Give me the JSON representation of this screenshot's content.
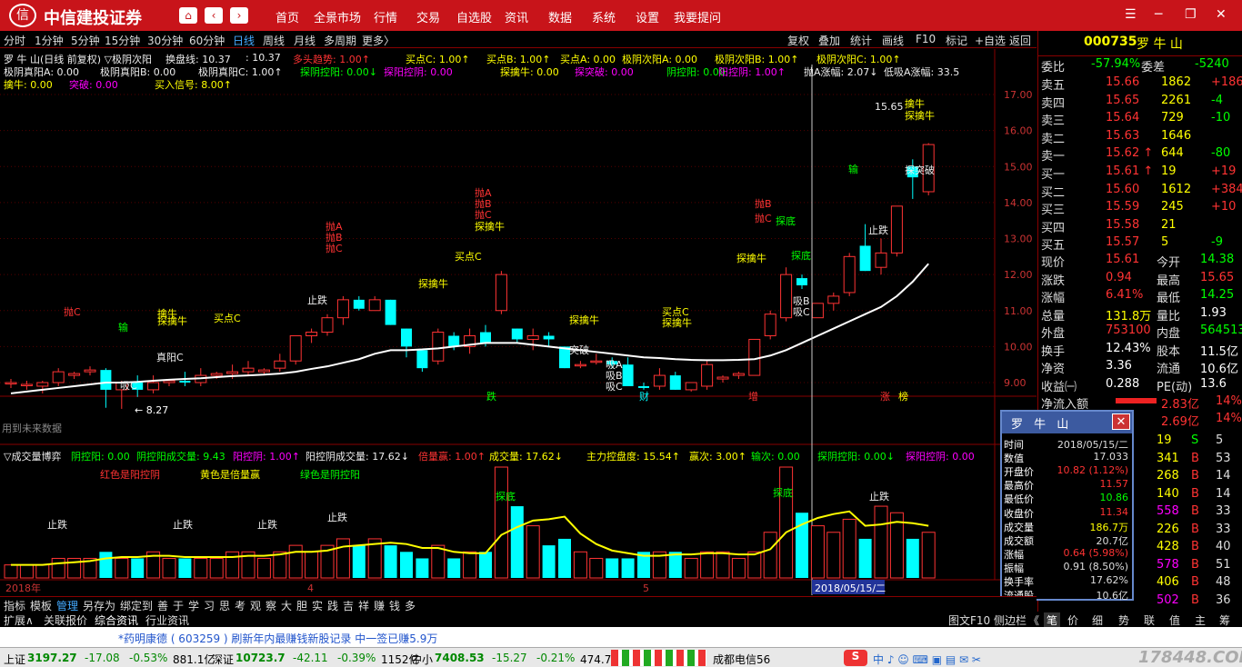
{
  "app": {
    "title": "中信建投证券",
    "logo_glyph": "信"
  },
  "menu": [
    "首页",
    "全景市场",
    "行情",
    "交易",
    "自选股",
    "资讯",
    "数据",
    "系统",
    "设置",
    "我要提问"
  ],
  "timeframes": [
    "分时",
    "1分钟",
    "5分钟",
    "15分钟",
    "30分钟",
    "60分钟",
    "日线",
    "周线",
    "月线",
    "多周期",
    "更多〉"
  ],
  "active_timeframe": "日线",
  "toolbar_right": [
    "复权",
    "叠加",
    "统计",
    "画线",
    "F10",
    "标记",
    "+自选",
    "返回"
  ],
  "indicators": {
    "row1": [
      {
        "t": "罗 牛 山(日线 前复权) ▽极阴次阳",
        "c": "w"
      },
      {
        "t": "换盘线: 10.37",
        "c": "w"
      },
      {
        "t": ": 10.37",
        "c": "w"
      },
      {
        "t": "多头趋势: 1.00↑",
        "c": "r"
      },
      {
        "t": "买点C: 1.00↑",
        "c": "y"
      },
      {
        "t": "买点B: 1.00↑",
        "c": "y"
      },
      {
        "t": "买点A: 0.00",
        "c": "y"
      },
      {
        "t": "极阴次阳A: 0.00",
        "c": "y"
      },
      {
        "t": "极阴次阳B: 1.00↑",
        "c": "y"
      },
      {
        "t": "极阴次阳C: 1.00↑",
        "c": "y"
      }
    ],
    "row2": [
      {
        "t": "极阴真阳A: 0.00",
        "c": "w"
      },
      {
        "t": "极阴真阳B: 0.00",
        "c": "w"
      },
      {
        "t": "极阴真阳C: 1.00↑",
        "c": "w"
      },
      {
        "t": "探阴控阳: 0.00↓",
        "c": "g"
      },
      {
        "t": "探阳控阴: 0.00",
        "c": "m"
      },
      {
        "t": "探擒牛: 0.00",
        "c": "y"
      },
      {
        "t": "探突破: 0.00",
        "c": "m"
      },
      {
        "t": "阴控阳: 0.00",
        "c": "g"
      },
      {
        "t": "阳控阴: 1.00↑",
        "c": "m"
      },
      {
        "t": "抛A涨幅: 2.07↓",
        "c": "w"
      },
      {
        "t": "低吸A涨幅: 33.5",
        "c": "w"
      }
    ],
    "row3": [
      {
        "t": "擒牛: 0.00",
        "c": "y"
      },
      {
        "t": "突破: 0.00",
        "c": "m"
      },
      {
        "t": "买入信号: 8.00↑",
        "c": "y"
      }
    ]
  },
  "volume_indicators": {
    "row1": [
      {
        "t": "▽成交量博弈",
        "c": "w"
      },
      {
        "t": "阴控阳: 0.00",
        "c": "g"
      },
      {
        "t": "阴控阳成交量: 9.43",
        "c": "g"
      },
      {
        "t": "阳控阴: 1.00↑",
        "c": "m"
      },
      {
        "t": "阳控阴成交量: 17.62↓",
        "c": "w"
      },
      {
        "t": "倍量赢: 1.00↑",
        "c": "r"
      },
      {
        "t": "成交量: 17.62↓",
        "c": "y"
      },
      {
        "t": "主力控盘度: 15.54↑",
        "c": "y"
      },
      {
        "t": "赢次: 3.00↑",
        "c": "y"
      },
      {
        "t": "输次: 0.00",
        "c": "g"
      },
      {
        "t": "探阴控阳: 0.00↓",
        "c": "g"
      },
      {
        "t": "探阳控阴: 0.00",
        "c": "m"
      }
    ],
    "row2": [
      {
        "t": "红色是阳控阴",
        "c": "r"
      },
      {
        "t": "黄色是倍量赢",
        "c": "y"
      },
      {
        "t": "绿色是阴控阳",
        "c": "g"
      }
    ]
  },
  "chart_data": {
    "type": "candlestick",
    "y_ticks": [
      "17.00",
      "16.00",
      "15.00",
      "14.00",
      "13.00",
      "12.00",
      "11.00",
      "10.00",
      "9.00"
    ],
    "ylim": [
      8.6,
      17.3
    ],
    "x_labels": [
      "2018年",
      "4",
      "5"
    ],
    "cursor_date": "2018/05/15/二",
    "max_label": "15.65",
    "min_label": "8.27",
    "future_note": "用到未来数据",
    "candles": [
      {
        "o": 9.0,
        "h": 9.1,
        "l": 8.85,
        "c": 9.0
      },
      {
        "o": 8.95,
        "h": 9.05,
        "l": 8.8,
        "c": 8.95
      },
      {
        "o": 8.9,
        "h": 9.05,
        "l": 8.7,
        "c": 9.0
      },
      {
        "o": 9.0,
        "h": 9.4,
        "l": 8.9,
        "c": 9.3
      },
      {
        "o": 9.2,
        "h": 9.3,
        "l": 9.1,
        "c": 9.25
      },
      {
        "o": 9.3,
        "h": 9.45,
        "l": 9.2,
        "c": 9.35
      },
      {
        "o": 9.35,
        "h": 9.4,
        "l": 8.3,
        "c": 8.8
      },
      {
        "o": 8.8,
        "h": 9.05,
        "l": 8.27,
        "c": 9.0
      },
      {
        "o": 9.0,
        "h": 9.2,
        "l": 8.6,
        "c": 8.8
      },
      {
        "o": 8.8,
        "h": 9.2,
        "l": 8.7,
        "c": 9.0
      },
      {
        "o": 9.0,
        "h": 9.1,
        "l": 8.9,
        "c": 9.05
      },
      {
        "o": 9.05,
        "h": 9.3,
        "l": 8.9,
        "c": 9.0
      },
      {
        "o": 9.0,
        "h": 9.4,
        "l": 8.9,
        "c": 9.2
      },
      {
        "o": 9.2,
        "h": 9.3,
        "l": 9.1,
        "c": 9.25
      },
      {
        "o": 9.25,
        "h": 9.5,
        "l": 9.1,
        "c": 9.3
      },
      {
        "o": 9.3,
        "h": 9.6,
        "l": 9.2,
        "c": 9.4
      },
      {
        "o": 9.3,
        "h": 9.4,
        "l": 9.2,
        "c": 9.35
      },
      {
        "o": 9.4,
        "h": 9.8,
        "l": 9.3,
        "c": 9.6
      },
      {
        "o": 9.6,
        "h": 10.3,
        "l": 9.5,
        "c": 10.3
      },
      {
        "o": 10.3,
        "h": 10.5,
        "l": 10.1,
        "c": 10.4
      },
      {
        "o": 10.4,
        "h": 10.9,
        "l": 10.3,
        "c": 10.8
      },
      {
        "o": 10.8,
        "h": 11.4,
        "l": 10.6,
        "c": 11.3
      },
      {
        "o": 11.3,
        "h": 11.4,
        "l": 11.0,
        "c": 11.05
      },
      {
        "o": 11.0,
        "h": 11.4,
        "l": 11.0,
        "c": 11.3
      },
      {
        "o": 11.3,
        "h": 11.3,
        "l": 10.6,
        "c": 10.6
      },
      {
        "o": 10.5,
        "h": 10.5,
        "l": 9.7,
        "c": 10.0
      },
      {
        "o": 9.9,
        "h": 9.9,
        "l": 9.3,
        "c": 9.4
      },
      {
        "o": 9.6,
        "h": 10.5,
        "l": 9.5,
        "c": 10.4
      },
      {
        "o": 10.3,
        "h": 10.4,
        "l": 9.9,
        "c": 10.0
      },
      {
        "o": 10.0,
        "h": 10.5,
        "l": 9.8,
        "c": 10.3
      },
      {
        "o": 10.4,
        "h": 10.6,
        "l": 10.0,
        "c": 10.1
      },
      {
        "o": 11.0,
        "h": 12.1,
        "l": 10.9,
        "c": 12.0
      },
      {
        "o": 10.5,
        "h": 10.5,
        "l": 10.1,
        "c": 10.2
      },
      {
        "o": 10.2,
        "h": 10.5,
        "l": 9.9,
        "c": 10.3
      },
      {
        "o": 10.3,
        "h": 10.4,
        "l": 10.0,
        "c": 10.2
      },
      {
        "o": 10.0,
        "h": 10.0,
        "l": 9.4,
        "c": 9.4
      },
      {
        "o": 9.5,
        "h": 9.6,
        "l": 9.4,
        "c": 9.5
      },
      {
        "o": 9.6,
        "h": 9.8,
        "l": 9.5,
        "c": 9.6
      },
      {
        "o": 9.6,
        "h": 9.7,
        "l": 9.4,
        "c": 9.5
      },
      {
        "o": 9.5,
        "h": 9.7,
        "l": 8.9,
        "c": 8.9
      },
      {
        "o": 8.9,
        "h": 9.0,
        "l": 8.8,
        "c": 8.85
      },
      {
        "o": 8.9,
        "h": 9.4,
        "l": 8.8,
        "c": 9.2
      },
      {
        "o": 9.2,
        "h": 9.3,
        "l": 8.8,
        "c": 8.8
      },
      {
        "o": 8.8,
        "h": 9.0,
        "l": 8.75,
        "c": 9.0
      },
      {
        "o": 8.9,
        "h": 9.6,
        "l": 8.8,
        "c": 9.5
      },
      {
        "o": 9.1,
        "h": 9.2,
        "l": 9.0,
        "c": 9.15
      },
      {
        "o": 9.2,
        "h": 9.3,
        "l": 9.1,
        "c": 9.25
      },
      {
        "o": 9.2,
        "h": 10.2,
        "l": 9.2,
        "c": 10.2
      },
      {
        "o": 10.3,
        "h": 11.0,
        "l": 10.2,
        "c": 10.9
      },
      {
        "o": 10.8,
        "h": 12.2,
        "l": 10.7,
        "c": 12.0
      },
      {
        "o": 11.9,
        "h": 12.0,
        "l": 11.6,
        "c": 11.7
      },
      {
        "o": 10.8,
        "h": 11.2,
        "l": 10.8,
        "c": 11.2
      },
      {
        "o": 11.2,
        "h": 11.5,
        "l": 11.0,
        "c": 11.4
      },
      {
        "o": 11.5,
        "h": 12.6,
        "l": 11.4,
        "c": 12.5
      },
      {
        "o": 12.8,
        "h": 13.4,
        "l": 12.1,
        "c": 12.1
      },
      {
        "o": 12.2,
        "h": 13.0,
        "l": 12.0,
        "c": 12.6
      },
      {
        "o": 12.6,
        "h": 13.9,
        "l": 12.5,
        "c": 13.9
      },
      {
        "o": 15.0,
        "h": 15.2,
        "l": 14.1,
        "c": 14.7
      },
      {
        "o": 14.3,
        "h": 15.65,
        "l": 14.2,
        "c": 15.61
      }
    ],
    "ma": [
      8.7,
      8.75,
      8.8,
      8.85,
      8.9,
      8.95,
      9.0,
      9.0,
      9.02,
      9.05,
      9.08,
      9.1,
      9.12,
      9.15,
      9.18,
      9.2,
      9.22,
      9.25,
      9.3,
      9.38,
      9.45,
      9.55,
      9.65,
      9.8,
      9.9,
      9.9,
      9.92,
      9.95,
      10.0,
      10.05,
      10.1,
      10.1,
      10.1,
      10.05,
      10.0,
      9.95,
      9.9,
      9.85,
      9.8,
      9.75,
      9.7,
      9.68,
      9.65,
      9.63,
      9.62,
      9.62,
      9.63,
      9.65,
      9.75,
      9.9,
      10.1,
      10.3,
      10.5,
      10.7,
      10.9,
      11.1,
      11.4,
      11.8,
      12.3
    ],
    "volumes": [
      2,
      2,
      2,
      3,
      3,
      3,
      4,
      3,
      3,
      4,
      3,
      3,
      3,
      3,
      4,
      4,
      3,
      4,
      5,
      4,
      5,
      6,
      5,
      6,
      5,
      4,
      3,
      5,
      3,
      4,
      4,
      17,
      11,
      8,
      5,
      6,
      4,
      3,
      3,
      3,
      4,
      4,
      4,
      3,
      4,
      4,
      3,
      4,
      7,
      17,
      10,
      8,
      7,
      9,
      6,
      11,
      10,
      6,
      7
    ]
  },
  "quote": {
    "code": "000735",
    "name": "罗 牛 山",
    "weibi": {
      "label": "委比",
      "value": "-57.94%"
    },
    "weicha": {
      "label": "委差",
      "value": "-5240"
    },
    "sells": [
      {
        "label": "卖五",
        "price": "15.66",
        "vol": "1862",
        "chg": "+1862"
      },
      {
        "label": "卖四",
        "price": "15.65",
        "vol": "2261",
        "chg": "-4"
      },
      {
        "label": "卖三",
        "price": "15.64",
        "vol": "729",
        "chg": "-10"
      },
      {
        "label": "卖二",
        "price": "15.63",
        "vol": "1646",
        "chg": ""
      },
      {
        "label": "卖一",
        "price": "15.62 ↑",
        "vol": "644",
        "chg": "-80"
      }
    ],
    "buys": [
      {
        "label": "买一",
        "price": "15.61 ↑",
        "vol": "19",
        "chg": "+19"
      },
      {
        "label": "买二",
        "price": "15.60",
        "vol": "1612",
        "chg": "+384"
      },
      {
        "label": "买三",
        "price": "15.59",
        "vol": "245",
        "chg": "+10"
      },
      {
        "label": "买四",
        "price": "15.58",
        "vol": "21",
        "chg": ""
      },
      {
        "label": "买五",
        "price": "15.57",
        "vol": "5",
        "chg": "-9"
      }
    ],
    "stats": [
      {
        "l1": "现价",
        "v1": "15.61",
        "l2": "今开",
        "v2": "14.38"
      },
      {
        "l1": "涨跌",
        "v1": "0.94",
        "l2": "最高",
        "v2": "15.65"
      },
      {
        "l1": "涨幅",
        "v1": "6.41%",
        "l2": "最低",
        "v2": "14.25"
      },
      {
        "l1": "总量",
        "v1": "131.8万",
        "l2": "量比",
        "v2": "1.93"
      },
      {
        "l1": "外盘",
        "v1": "753100",
        "l2": "内盘",
        "v2": "564513"
      },
      {
        "l1": "换手",
        "v1": "12.43%",
        "l2": "股本",
        "v2": "11.5亿"
      },
      {
        "l1": "净资",
        "v1": "3.36",
        "l2": "流通",
        "v2": "10.6亿"
      },
      {
        "l1": "收益㈠",
        "v1": "0.288",
        "l2": "PE(动)",
        "v2": "13.6"
      }
    ],
    "inflow_label": "净流入额",
    "inflow1": {
      "value": "2.83亿",
      "pct": "14%"
    },
    "inflow2": {
      "value": "2.69亿",
      "pct": "14%"
    },
    "ticks": [
      {
        "v": "19",
        "s": "S",
        "n": "5"
      },
      {
        "v": "341",
        "s": "B",
        "n": "53"
      },
      {
        "v": "268",
        "s": "B",
        "n": "14"
      },
      {
        "v": "140",
        "s": "B",
        "n": "14"
      },
      {
        "v": "558",
        "s": "B",
        "n": "33"
      },
      {
        "v": "226",
        "s": "B",
        "n": "33"
      },
      {
        "v": "428",
        "s": "B",
        "n": "40"
      },
      {
        "v": "578",
        "s": "B",
        "n": "51"
      },
      {
        "v": "406",
        "s": "B",
        "n": "48"
      },
      {
        "v": "502",
        "s": "B",
        "n": "36"
      }
    ]
  },
  "popup": {
    "title": "罗 牛 山",
    "rows": [
      {
        "k": "时间",
        "v": "2018/05/15/二"
      },
      {
        "k": "数值",
        "v": "17.033"
      },
      {
        "k": "开盘价",
        "v": "10.82 (1.12%)"
      },
      {
        "k": "最高价",
        "v": "11.57"
      },
      {
        "k": "最低价",
        "v": "10.86"
      },
      {
        "k": "收盘价",
        "v": "11.34"
      },
      {
        "k": "成交量",
        "v": "186.7万"
      },
      {
        "k": "成交额",
        "v": "20.7亿"
      },
      {
        "k": "涨幅",
        "v": "0.64 (5.98%)"
      },
      {
        "k": "振幅",
        "v": "0.91 (8.50%)"
      },
      {
        "k": "换手率",
        "v": "17.62%"
      },
      {
        "k": "流通股",
        "v": "10.6亿"
      }
    ]
  },
  "bottom_tabs": [
    "指标",
    "模板",
    "管理",
    "另存为",
    "绑定到",
    "善",
    "于",
    "学",
    "习",
    "思",
    "考",
    "观",
    "察",
    "大",
    "胆",
    "实",
    "践",
    "吉",
    "祥",
    "赚",
    "钱",
    "多"
  ],
  "sub_tabs": [
    "扩展∧",
    "关联报价",
    "综合资讯",
    "行业资讯"
  ],
  "sub_right": [
    "图文F10",
    "侧边栏",
    "《",
    "笔",
    "价",
    "细",
    "势",
    "联",
    "值",
    "主",
    "筹"
  ],
  "ticker_text": "*药明康德 ( 603259 ) 刷新年内最赚钱新股记录  中一签已赚5.9万",
  "status": [
    {
      "name": "上证",
      "val": "3197.27",
      "chg": "-17.08",
      "pct": "-0.53%",
      "amt": "881.1亿"
    },
    {
      "name": "深证",
      "val": "10723.7",
      "chg": "-42.11",
      "pct": "-0.39%",
      "amt": "1152亿"
    },
    {
      "name": "中小",
      "val": "7408.53",
      "chg": "-15.27",
      "pct": "-0.21%",
      "amt": "474.7亿"
    }
  ],
  "status_server": "成都电信56",
  "status_icons": "中 ♪ ☺ ⌨ ▣ ▤ ✉ ✂",
  "watermark": "178448.COM",
  "markers": {
    "main": [
      {
        "t": "抛C",
        "c": "r",
        "x": 70,
        "y": 339
      },
      {
        "t": "输",
        "c": "g",
        "x": 130,
        "y": 356
      },
      {
        "t": "擒牛",
        "c": "y",
        "x": 173,
        "y": 341
      },
      {
        "t": "探擒牛",
        "c": "y",
        "x": 173,
        "y": 349
      },
      {
        "t": "买点C",
        "c": "y",
        "x": 235,
        "y": 346
      },
      {
        "t": "抛A",
        "c": "r",
        "x": 358,
        "y": 245
      },
      {
        "t": "抛B",
        "c": "r",
        "x": 358,
        "y": 257
      },
      {
        "t": "抛C",
        "c": "r",
        "x": 358,
        "y": 269
      },
      {
        "t": "止跌",
        "c": "w",
        "x": 338,
        "y": 326
      },
      {
        "t": "探擒牛",
        "c": "y",
        "x": 460,
        "y": 308
      },
      {
        "t": "抛A",
        "c": "r",
        "x": 522,
        "y": 208
      },
      {
        "t": "抛B",
        "c": "r",
        "x": 522,
        "y": 220
      },
      {
        "t": "抛C",
        "c": "r",
        "x": 522,
        "y": 232
      },
      {
        "t": "探擒牛",
        "c": "y",
        "x": 522,
        "y": 245
      },
      {
        "t": "买点C",
        "c": "y",
        "x": 500,
        "y": 278
      },
      {
        "t": "突破",
        "c": "w",
        "x": 626,
        "y": 381
      },
      {
        "t": "探擒牛",
        "c": "y",
        "x": 626,
        "y": 348
      },
      {
        "t": "买点C",
        "c": "y",
        "x": 728,
        "y": 339
      },
      {
        "t": "探擒牛",
        "c": "y",
        "x": 728,
        "y": 351
      },
      {
        "t": "抛B",
        "c": "r",
        "x": 830,
        "y": 220
      },
      {
        "t": "抛C",
        "c": "r",
        "x": 830,
        "y": 236
      },
      {
        "t": "探底",
        "c": "g",
        "x": 853,
        "y": 239
      },
      {
        "t": "探擒牛",
        "c": "y",
        "x": 810,
        "y": 280
      },
      {
        "t": "探底",
        "c": "g",
        "x": 870,
        "y": 277
      },
      {
        "t": "输",
        "c": "g",
        "x": 933,
        "y": 182
      },
      {
        "t": "止跌",
        "c": "w",
        "x": 955,
        "y": 249
      },
      {
        "t": "15.65",
        "c": "w",
        "x": 962,
        "y": 113
      },
      {
        "t": "擒牛",
        "c": "y",
        "x": 995,
        "y": 110
      },
      {
        "t": "探擒牛",
        "c": "y",
        "x": 995,
        "y": 123
      },
      {
        "t": "探突破",
        "c": "w",
        "x": 995,
        "y": 183
      },
      {
        "t": "吸C",
        "c": "w",
        "x": 132,
        "y": 420
      },
      {
        "t": "真阳C",
        "c": "w",
        "x": 172,
        "y": 389
      },
      {
        "t": "吸A",
        "c": "w",
        "x": 666,
        "y": 397
      },
      {
        "t": "吸B",
        "c": "w",
        "x": 666,
        "y": 409
      },
      {
        "t": "吸C",
        "c": "w",
        "x": 666,
        "y": 421
      },
      {
        "t": "吸B",
        "c": "w",
        "x": 872,
        "y": 327
      },
      {
        "t": "吸C",
        "c": "w",
        "x": 872,
        "y": 339
      },
      {
        "t": "跌",
        "c": "g",
        "x": 535,
        "y": 432
      },
      {
        "t": "财",
        "c": "c",
        "x": 703,
        "y": 432
      },
      {
        "t": "增",
        "c": "r",
        "x": 823,
        "y": 432
      },
      {
        "t": "涨",
        "c": "r",
        "x": 968,
        "y": 432
      },
      {
        "t": "榜",
        "c": "y",
        "x": 988,
        "y": 432
      }
    ],
    "volume": [
      {
        "t": "止跌",
        "c": "w",
        "x": 52,
        "y": 573
      },
      {
        "t": "止跌",
        "c": "w",
        "x": 190,
        "y": 573
      },
      {
        "t": "止跌",
        "c": "w",
        "x": 283,
        "y": 573
      },
      {
        "t": "止跌",
        "c": "w",
        "x": 360,
        "y": 565
      },
      {
        "t": "探底",
        "c": "g",
        "x": 545,
        "y": 542
      },
      {
        "t": "探底",
        "c": "g",
        "x": 850,
        "y": 538
      },
      {
        "t": "止跌",
        "c": "w",
        "x": 956,
        "y": 542
      }
    ]
  }
}
